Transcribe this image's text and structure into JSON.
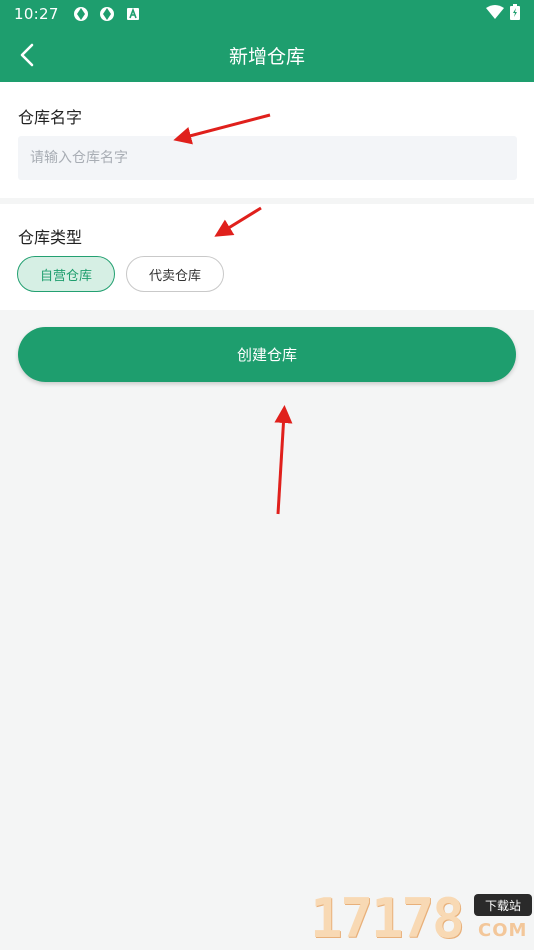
{
  "status_bar": {
    "time": "10:27",
    "left_icons": [
      "sync-icon",
      "sync-icon",
      "notification-a-icon"
    ],
    "right_icons": [
      "wifi-icon",
      "battery-icon"
    ]
  },
  "app_bar": {
    "title": "新增仓库",
    "back_icon": "chevron-left-icon"
  },
  "form": {
    "name_section": {
      "label": "仓库名字",
      "value": "",
      "placeholder": "请输入仓库名字"
    },
    "type_section": {
      "label": "仓库类型",
      "options": [
        "自营仓库",
        "代卖仓库"
      ],
      "selected": "自营仓库"
    },
    "create_button": "创建仓库"
  },
  "watermark": {
    "number": "17178",
    "tag": "下载站",
    "suffix": "COM"
  },
  "colors": {
    "brand": "#1e9e6e",
    "chip_active_bg": "#d6efe4",
    "annotation_arrow": "#e0201c"
  }
}
